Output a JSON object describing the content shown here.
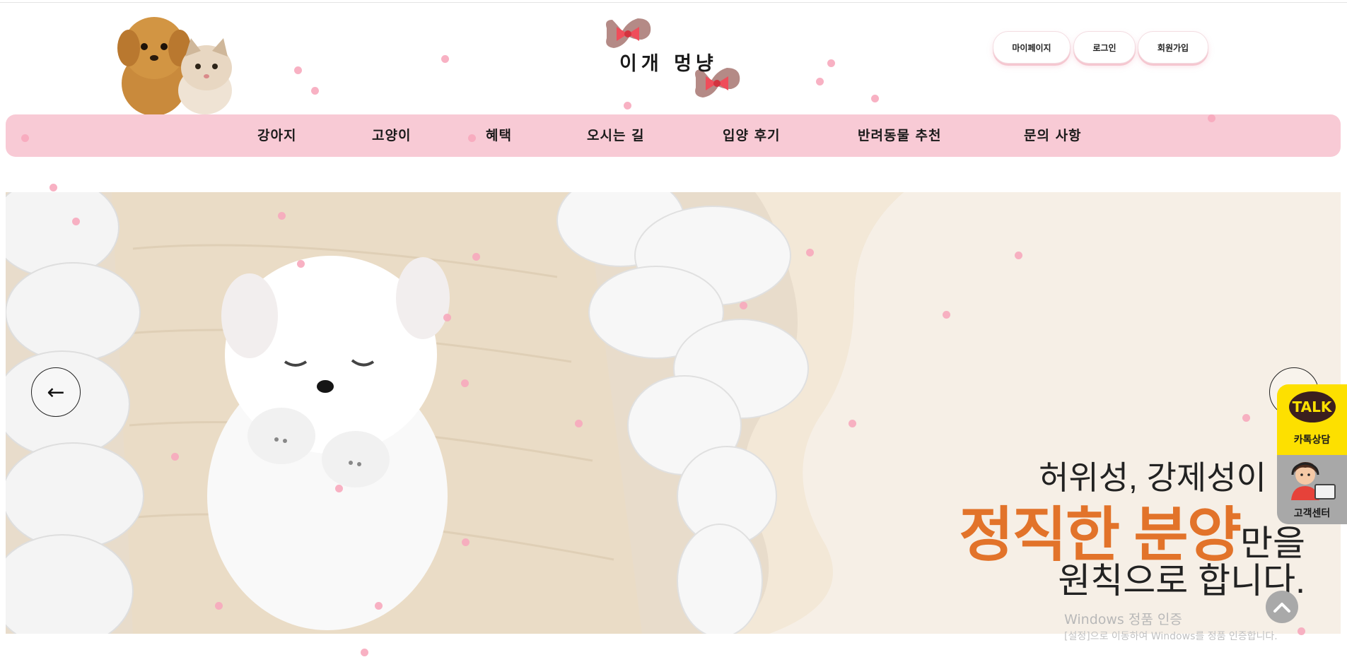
{
  "header": {
    "brand_name": "이개 멍냥",
    "auth_links": [
      "마이페이지",
      "로그인",
      "회원가입"
    ]
  },
  "nav": {
    "items": [
      "강아지",
      "고양이",
      "혜택",
      "오시는 길",
      "입양 후기",
      "반려동물 추천",
      "문의 사항"
    ]
  },
  "banner": {
    "prev_symbol": "←",
    "line1": "허위성, 강제성이 없",
    "highlight": "정직한 분양",
    "line2_tail": "만을",
    "line3": "원칙으로 합니다."
  },
  "widgets": {
    "kakao_bubble": "TALK",
    "kakao_label": "카톡상담",
    "support_label": "고객센터"
  },
  "windows_notice": {
    "title": "Windows 정품 인증",
    "subtitle": "[설정]으로 이동하여 Windows를 정품 인증합니다."
  },
  "colors": {
    "nav_bg": "#f8cad5",
    "highlight": "#e2732a",
    "kakao": "#fde000",
    "petal": "#f7a9bd"
  }
}
